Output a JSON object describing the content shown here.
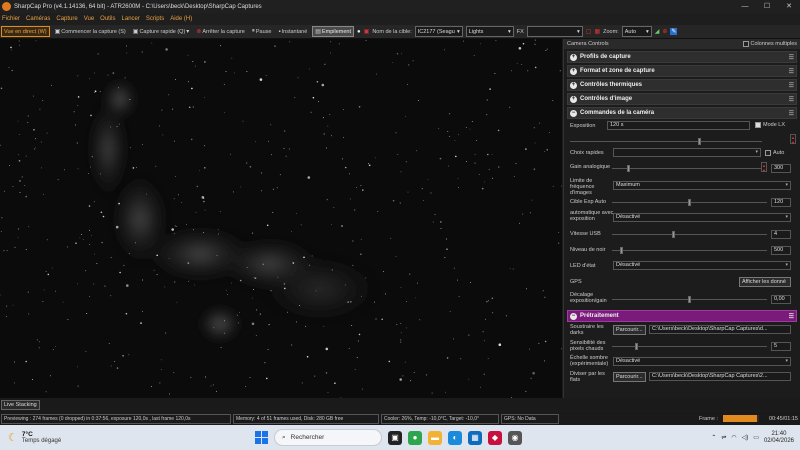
{
  "window": {
    "title": "SharpCap Pro (v4.1.14136, 64 bit) - ATR2600M - C:\\Users\\beck\\Desktop\\SharpCap Captures",
    "minimize": "—",
    "maximize": "☐",
    "close": "✕"
  },
  "menu": [
    "Fichier",
    "Caméras",
    "Capture",
    "Vue",
    "Outils",
    "Lancer",
    "Scripts",
    "Aide (H)"
  ],
  "toolbar": {
    "live_view": "Vue en direct (W)",
    "start_capture": "Commencer la capture (S)",
    "quick_capture": "Capture rapide (Q)",
    "stop_capture": "Arrêter la capture",
    "pause": "Pause",
    "snapshot": "Instantané",
    "stacking": "Empilement",
    "target_label": "Nom de la cible:",
    "target_value": "IC2177 (Seagu",
    "frame_type": "Lights",
    "fx_label": "FX",
    "fx_value": "",
    "zoom_label": "Zoom:",
    "zoom_value": "Auto"
  },
  "panel": {
    "header": "Camera Controls",
    "multi_columns": "Colonnes multiples",
    "sections": {
      "profiles": "Profils de capture",
      "format": "Format et zone de capture",
      "thermal": "Contrôles thermiques",
      "image": "Contrôles d'image",
      "camera": "Commandes de la caméra",
      "preprocessing": "Prétraitement"
    },
    "exposure": {
      "label": "Exposition",
      "value": "120 s",
      "lx_label": "Mode LX",
      "lx_checked": true
    },
    "quick_choices": {
      "label": "Choix rapides",
      "value": "",
      "auto_label": "Auto"
    },
    "gain": {
      "label": "Gain analogique",
      "value": "300",
      "level": 0.1
    },
    "frame_rate_limit": {
      "label": "Limite de fréquence d'images",
      "value": "Maximum"
    },
    "auto_exp_target": {
      "label": "Cible Exp Auto",
      "value": "120",
      "level": 0.5
    },
    "auto_with_exposure": {
      "label": "automatique avec exposition",
      "value": "Désactivé"
    },
    "usb_speed": {
      "label": "Vitesse USB",
      "value": "4",
      "level": 0.4
    },
    "black_level": {
      "label": "Niveau de noir",
      "value": "500",
      "level": 0.05
    },
    "led": {
      "label": "LED d'état",
      "value": "Désactivé"
    },
    "gps": {
      "label": "GPS",
      "button": "Afficher les donné"
    },
    "exp_offset": {
      "label": "Décalage exposition/gain",
      "value": "0,00",
      "level": 0.5
    },
    "darks": {
      "label": "Soustraire les darks",
      "browse": "Parcourir...",
      "path": "C:\\Users\\beck\\Desktop\\SharpCap Captures\\d..."
    },
    "hot_pixels": {
      "label": "Sensibilité des pixels chauds",
      "value": "5",
      "level": 0.15
    },
    "dark_scale": {
      "label": "Échelle sombre (expérimentale)",
      "value": "Désactivé"
    },
    "flats": {
      "label": "Diviser par les flats",
      "browse": "Parcourir...",
      "path": "C:\\Users\\beck\\Desktop\\SharpCap Captures\\2..."
    }
  },
  "live_stacking_tab": "Live Stacking",
  "status": {
    "preview": "Previewing : 274 frames (0 dropped) in 0:37:56, exposure 120,0s , last frame 120,0s",
    "memory": "Memory: 4 of 51 frames used, Disk: 280 GB free",
    "cooler": "Cooler: 26%, Temp: -10,0°C, Target: -10,0°",
    "gps": "GPS: No Data",
    "frame_label": "Frame :",
    "frame_progress": 0.95,
    "elapsed": "00:45/01:15"
  },
  "taskbar": {
    "temperature": "7°C",
    "weather": "Temps dégagé",
    "search_placeholder": "Rechercher",
    "time": "21:40",
    "date": "02/04/2026"
  },
  "colors": {
    "accent": "#e08a20",
    "menu_text": "#e8a040",
    "preprocessing": "#7a1a7a"
  }
}
